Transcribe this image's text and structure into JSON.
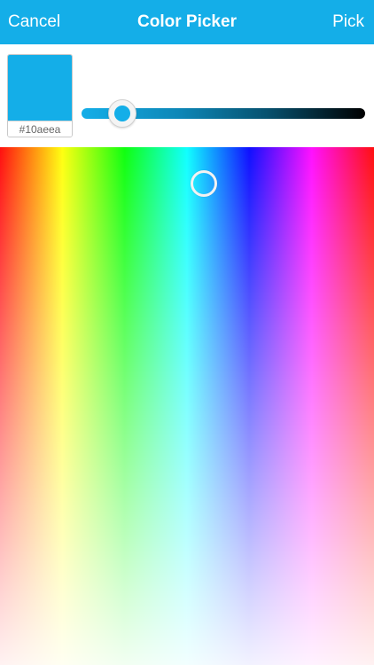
{
  "nav": {
    "cancel_label": "Cancel",
    "title": "Color Picker",
    "pick_label": "Pick"
  },
  "color": {
    "selected_hex": "#10aeea",
    "swatch_color": "#14aee8",
    "nav_background": "#14aee8"
  },
  "brightness_slider": {
    "level": 0.1
  },
  "spectrum": {
    "selected_hue_fraction": 0.545,
    "selected_saturation_fraction": 0.07
  }
}
